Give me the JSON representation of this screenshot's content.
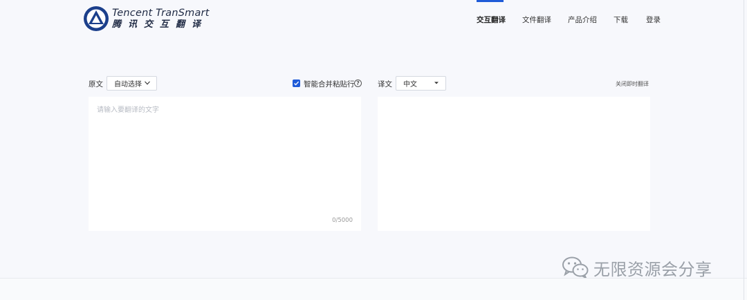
{
  "brand": {
    "name_en": "Tencent TranSmart",
    "name_cn": "腾讯交互翻译",
    "logo_color": "#1b3f8b"
  },
  "nav": {
    "items": [
      {
        "label": "交互翻译",
        "active": true
      },
      {
        "label": "文件翻译",
        "active": false
      },
      {
        "label": "产品介绍",
        "active": false
      },
      {
        "label": "下载",
        "active": false
      },
      {
        "label": "登录",
        "active": false
      }
    ],
    "accent": "#1f5bd8"
  },
  "source": {
    "label": "原文",
    "language": "自动选择",
    "merge_paste_label": "智能合并粘贴行",
    "merge_paste_checked": true,
    "placeholder": "请输入要翻译的文字",
    "counter": "0/5000"
  },
  "target": {
    "label": "译文",
    "language": "中文",
    "instant_toggle": "关闭即时翻译"
  },
  "watermark": {
    "text": "无限资源会分享",
    "icon": "wechat-icon"
  }
}
